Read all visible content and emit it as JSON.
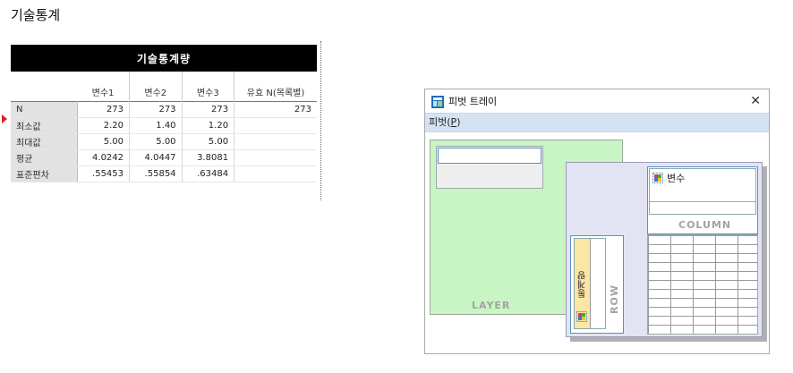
{
  "page": {
    "title": "기술통계"
  },
  "output_table": {
    "title": "기술통계량",
    "columns": [
      "",
      "변수1",
      "변수2",
      "변수3",
      "유효 N(목록별)"
    ],
    "rows": [
      {
        "label": "N",
        "values": [
          "273",
          "273",
          "273",
          "273"
        ]
      },
      {
        "label": "최소값",
        "values": [
          "2.20",
          "1.40",
          "1.20",
          ""
        ]
      },
      {
        "label": "최대값",
        "values": [
          "5.00",
          "5.00",
          "5.00",
          ""
        ]
      },
      {
        "label": "평균",
        "values": [
          "4.0242",
          "4.0447",
          "3.8081",
          ""
        ]
      },
      {
        "label": "표준편차",
        "values": [
          ".55453",
          ".55854",
          ".63484",
          ""
        ]
      }
    ],
    "marker_color": "#e02020"
  },
  "pivot_tray": {
    "window_title": "피벗 트레이",
    "close_label": "✕",
    "menu": {
      "label_before": "피벗(",
      "mnemonic": "P",
      "label_after": ")"
    },
    "zones": {
      "layer_label": "LAYER",
      "column_label": "COLUMN",
      "row_label": "ROW"
    },
    "column_item": "변수",
    "row_item": "통계량",
    "colors": {
      "layer": "#c9f5c5",
      "pivot_area": "#e2e4f4",
      "row_chip": "#fbe6a5",
      "menubar": "#d4e3f4"
    }
  }
}
